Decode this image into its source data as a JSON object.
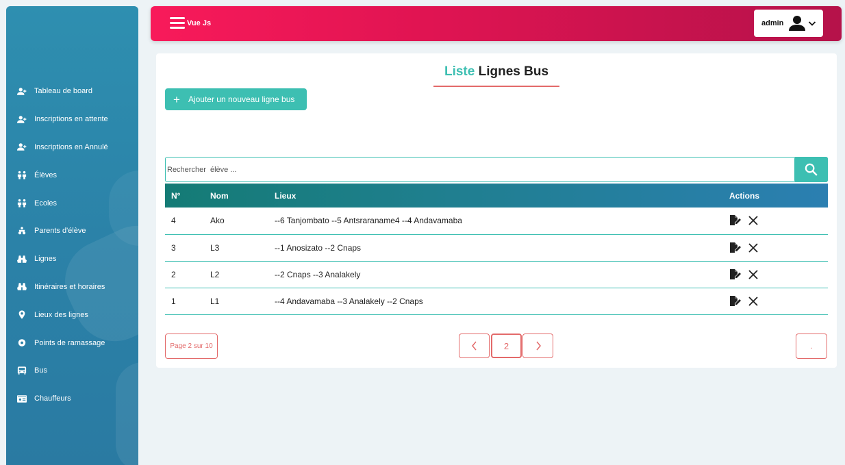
{
  "header": {
    "brand": "Vue Js",
    "user_name": "admin"
  },
  "sidebar": {
    "items": [
      {
        "label": "Tableau de board",
        "icon": "user-plus-icon"
      },
      {
        "label": "Inscriptions en attente",
        "icon": "user-plus-icon"
      },
      {
        "label": "Inscriptions en Annulé",
        "icon": "user-plus-icon"
      },
      {
        "label": "Élèves",
        "icon": "children-icon"
      },
      {
        "label": "Ecoles",
        "icon": "children-icon"
      },
      {
        "label": "Parents d'élève",
        "icon": "family-icon"
      },
      {
        "label": "Lignes",
        "icon": "binoculars-icon"
      },
      {
        "label": "Itinéraires et horaires",
        "icon": "binoculars-icon"
      },
      {
        "label": "Lieux des lignes",
        "icon": "map-marker-icon"
      },
      {
        "label": "Points de ramassage",
        "icon": "dot-circle-icon"
      },
      {
        "label": "Bus",
        "icon": "bus-icon"
      },
      {
        "label": "Chauffeurs",
        "icon": "id-card-icon"
      }
    ]
  },
  "main": {
    "title_accent": "Liste",
    "title_rest": "Lignes Bus",
    "add_button": "Ajouter un nouveau ligne bus",
    "search_placeholder": "Rechercher  élève ...",
    "table": {
      "headers": {
        "num": "N°",
        "nom": "Nom",
        "lieux": "Lieux",
        "actions": "Actions"
      },
      "rows": [
        {
          "num": "4",
          "nom": "Ako",
          "lieux": "--6 Tanjombato --5 Antsraraname4 --4 Andavamaba"
        },
        {
          "num": "3",
          "nom": "L3",
          "lieux": "--1 Anosizato --2 Cnaps"
        },
        {
          "num": "2",
          "nom": "L2",
          "lieux": "--2 Cnaps --3 Analakely"
        },
        {
          "num": "1",
          "nom": "L1",
          "lieux": "--4 Andavamaba --3 Analakely --2 Cnaps"
        }
      ]
    },
    "pagination": {
      "info": "Page 2 sur 10",
      "prev": "‹",
      "current": "2",
      "next": "›",
      "end": "."
    }
  },
  "colors": {
    "accent_teal": "#3dbfb2",
    "header_pink": "#f81a5a",
    "sidebar_blue": "#2e8fb0",
    "pager_red": "#e36a6a"
  }
}
